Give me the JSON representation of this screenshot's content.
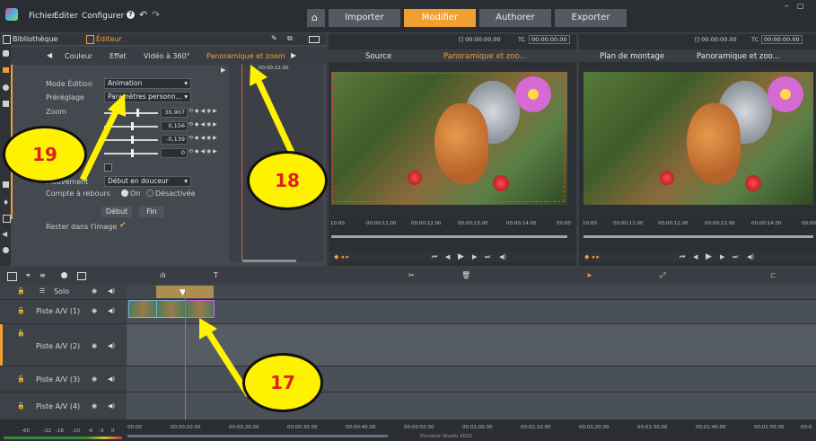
{
  "menu": {
    "file": "Fichier",
    "edit": "Editer",
    "configure": "Configurer"
  },
  "nav": {
    "import": "Importer",
    "edit": "Modifier",
    "author": "Authorer",
    "export": "Exporter"
  },
  "library": {
    "library_label": "Bibliothèque",
    "editor_label": "Éditeur"
  },
  "editor_tabs": [
    "Couleur",
    "Effet",
    "Vidéo à 360°",
    "Panoramique et zoom"
  ],
  "editor_time": "00:00:12.00",
  "editor": {
    "mode_label": "Mode Édition",
    "mode_value": "Animation",
    "preset_label": "Préréglage",
    "preset_value": "Paramètres personn...",
    "zoom_label": "Zoom",
    "zoom_value": "30,907",
    "x_value": "0,156",
    "y_value": "-0,139",
    "rot_value": "0",
    "movement_label": "Mouvement",
    "movement_value": "Début en douceur",
    "countdown_label": "Compte à rebours",
    "on_label": "On",
    "off_label": "Désactivée",
    "start_btn": "Début",
    "end_btn": "Fin",
    "stay_label": "Rester dans l'image"
  },
  "source_pane": {
    "timecode": "[] 00:00:00.00",
    "tc_label": "TC",
    "tc_value": "00:00:00.00",
    "tab1": "Source",
    "tab2": "Panoramique et zoo...",
    "ruler": [
      "10:00",
      "00:00:11.00",
      "00:00:12.00",
      "00:00:13.00",
      "00:00:14.00",
      "00:00"
    ]
  },
  "timeline_pane": {
    "timecode": "[] 00:00:00.00",
    "tc_label": "TC",
    "tc_value": "00:00:00.00",
    "tab1": "Plan de montage",
    "tab2": "Panoramique et zoo...",
    "ruler": [
      "10:00",
      "00:00:11.00",
      "00:00:12.00",
      "00:00:13.00",
      "00:00:14.00",
      "00:00"
    ]
  },
  "tracks": {
    "solo": "Solo",
    "t1": "Piste A/V (1)",
    "t2": "Piste A/V (2)",
    "t3": "Piste A/V (3)",
    "t4": "Piste A/V (4)"
  },
  "bottom_ruler": [
    "00:00",
    "00:00:10.00",
    "00:00:20.00",
    "00:00:30.00",
    "00:00:40.00",
    "00:00:50.00",
    "00:01:00.00",
    "00:01:10.00",
    "00:01:20.00",
    "00:01:30.00",
    "00:01:40.00",
    "00:01:50.00",
    "00:0"
  ],
  "level_meter": [
    "-60",
    "-22",
    "-16",
    "-10",
    "-6",
    "-3",
    "0"
  ],
  "footer": "Pinnacle Studio 2022",
  "annotations": {
    "b17": "17",
    "b18": "18",
    "b19": "19"
  },
  "colors": {
    "accent": "#f0a030",
    "annotation_fill": "#fff200",
    "annotation_text": "#e02020"
  }
}
